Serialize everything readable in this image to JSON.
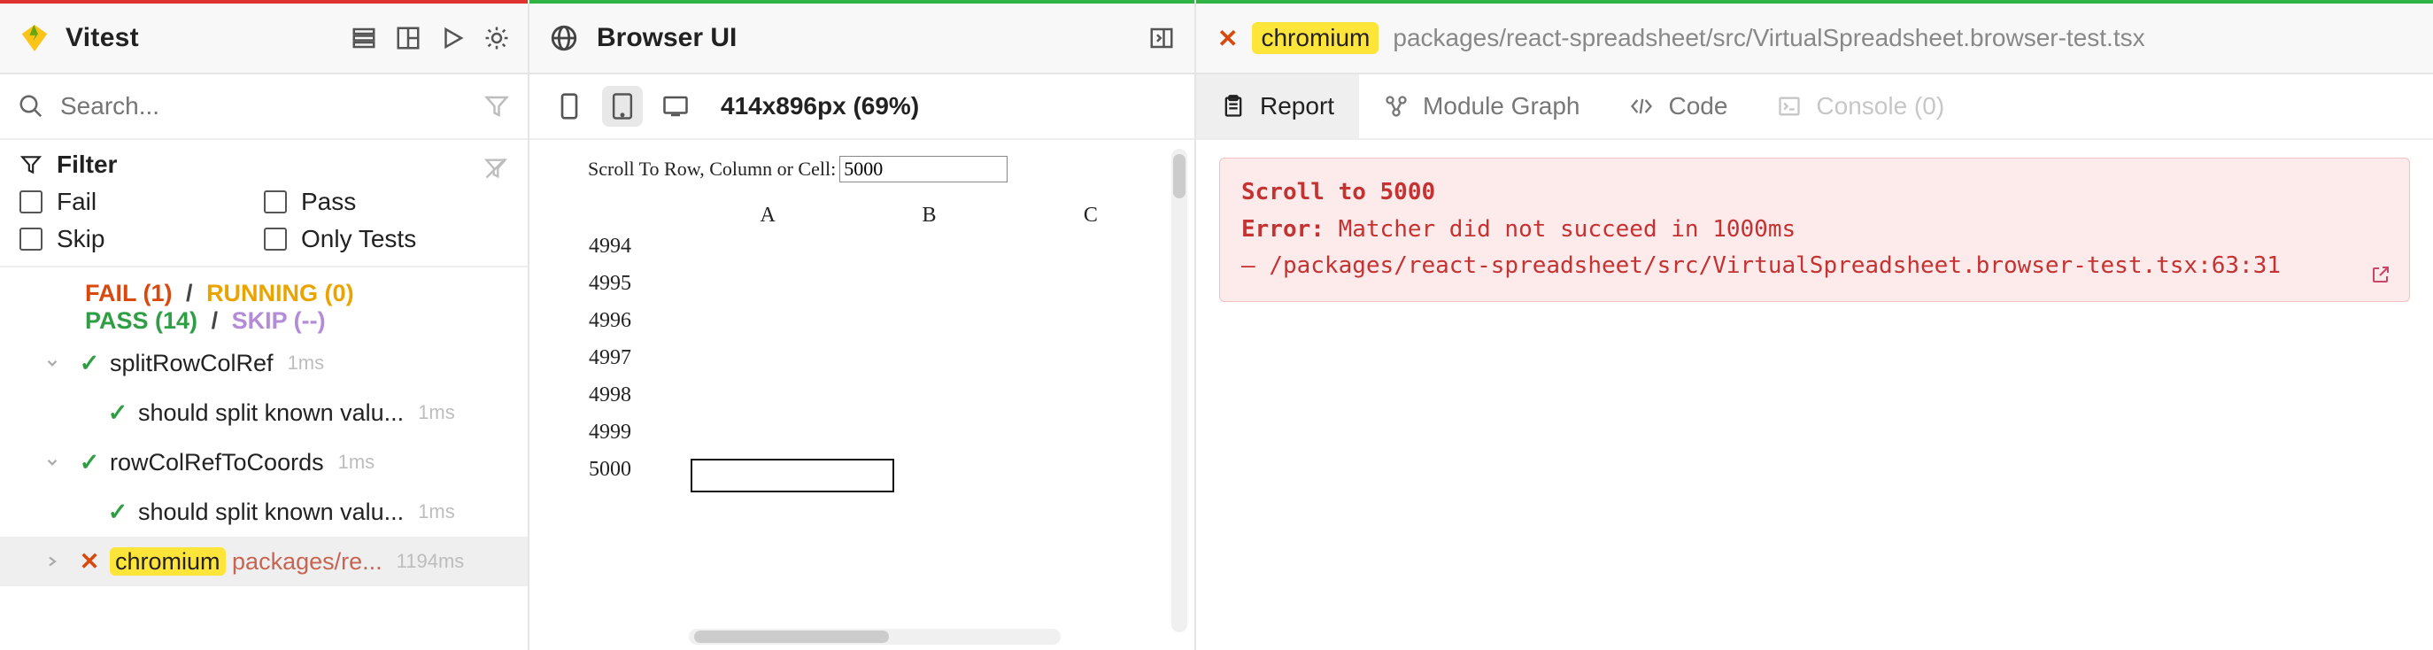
{
  "app": {
    "title": "Vitest"
  },
  "search": {
    "placeholder": "Search..."
  },
  "filter": {
    "title": "Filter",
    "options": {
      "fail": "Fail",
      "pass": "Pass",
      "skip": "Skip",
      "only": "Only Tests"
    }
  },
  "stats": {
    "fail_label": "FAIL (1)",
    "running_label": "RUNNING (0)",
    "pass_label": "PASS (14)",
    "skip_label": "SKIP (--)",
    "sep": "/"
  },
  "tests": [
    {
      "status": "pass",
      "caret": true,
      "depth": 1,
      "label": "splitRowColRef",
      "duration": "1ms"
    },
    {
      "status": "pass",
      "caret": false,
      "depth": 2,
      "label": "should split known valu...",
      "duration": "1ms"
    },
    {
      "status": "pass",
      "caret": true,
      "depth": 1,
      "label": "rowColRefToCoords",
      "duration": "1ms"
    },
    {
      "status": "pass",
      "caret": false,
      "depth": 2,
      "label": "should split known valu...",
      "duration": "1ms"
    },
    {
      "status": "fail",
      "caret": true,
      "depth": 1,
      "highlight": "chromium",
      "label_tail": "packages/re...",
      "duration": "1194ms",
      "selected": true
    }
  ],
  "browser": {
    "title": "Browser UI",
    "viewport": "414x896px (69%)",
    "scroll_label": "Scroll To Row, Column or Cell:",
    "scroll_value": "5000",
    "columns": [
      "A",
      "B",
      "C"
    ],
    "rows": [
      "4994",
      "4995",
      "4996",
      "4997",
      "4998",
      "4999",
      "5000"
    ]
  },
  "report_header": {
    "browser": "chromium",
    "path": "packages/react-spreadsheet/src/VirtualSpreadsheet.browser-test.tsx"
  },
  "tabs": {
    "report": "Report",
    "module": "Module Graph",
    "code": "Code",
    "console": "Console (0)"
  },
  "error": {
    "title": "Scroll to 5000",
    "line_error_prefix": "Error:",
    "line_error_msg": " Matcher did not succeed in 1000ms",
    "stack_prefix": "  – ",
    "stack": "/packages/react-spreadsheet/src/VirtualSpreadsheet.browser-test.tsx:63:31"
  }
}
